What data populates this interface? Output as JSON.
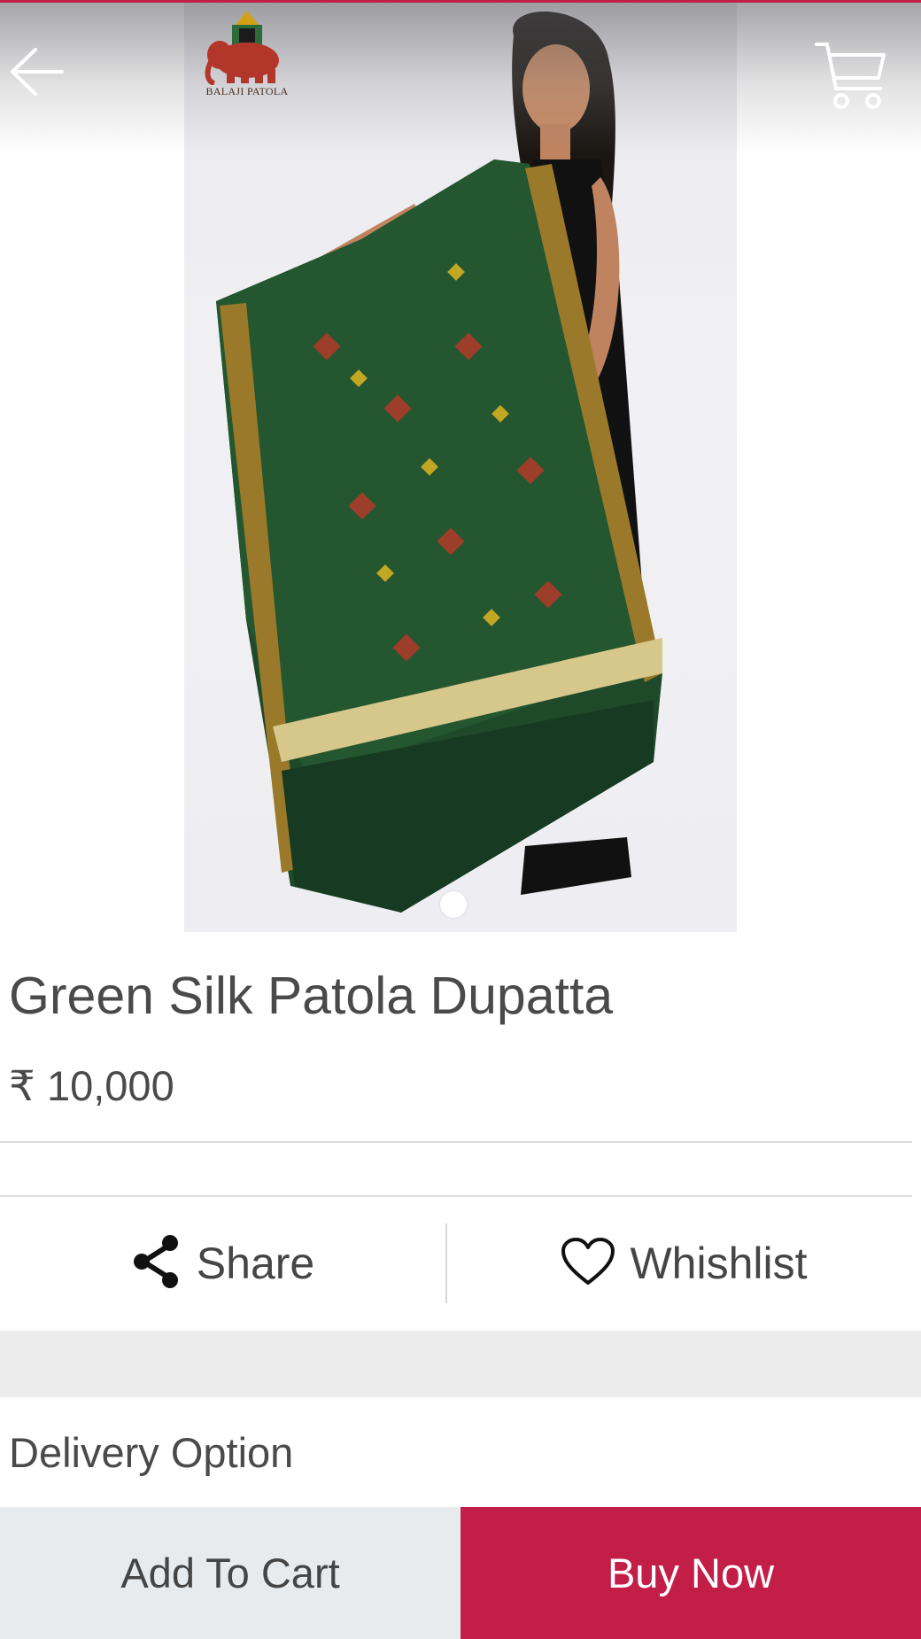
{
  "header": {
    "back_icon": "arrow-left-icon",
    "cart_icon": "shopping-cart-icon",
    "logo_text": "BALAJI PATOLA"
  },
  "product": {
    "title": "Green Silk Patola Dupatta",
    "price": "₹ 10,000",
    "image_count": 1,
    "active_image": 1
  },
  "actions": {
    "share_label": "Share",
    "share_icon": "share-icon",
    "wishlist_label": "Whishlist",
    "wishlist_icon": "heart-outline-icon"
  },
  "delivery": {
    "heading": "Delivery Option"
  },
  "footer": {
    "add_to_cart_label": "Add To Cart",
    "buy_now_label": "Buy Now"
  },
  "colors": {
    "accent": "#c21e48",
    "secondary_button": "#e8ebee",
    "text": "#4a4a4a",
    "band": "#ececec"
  }
}
